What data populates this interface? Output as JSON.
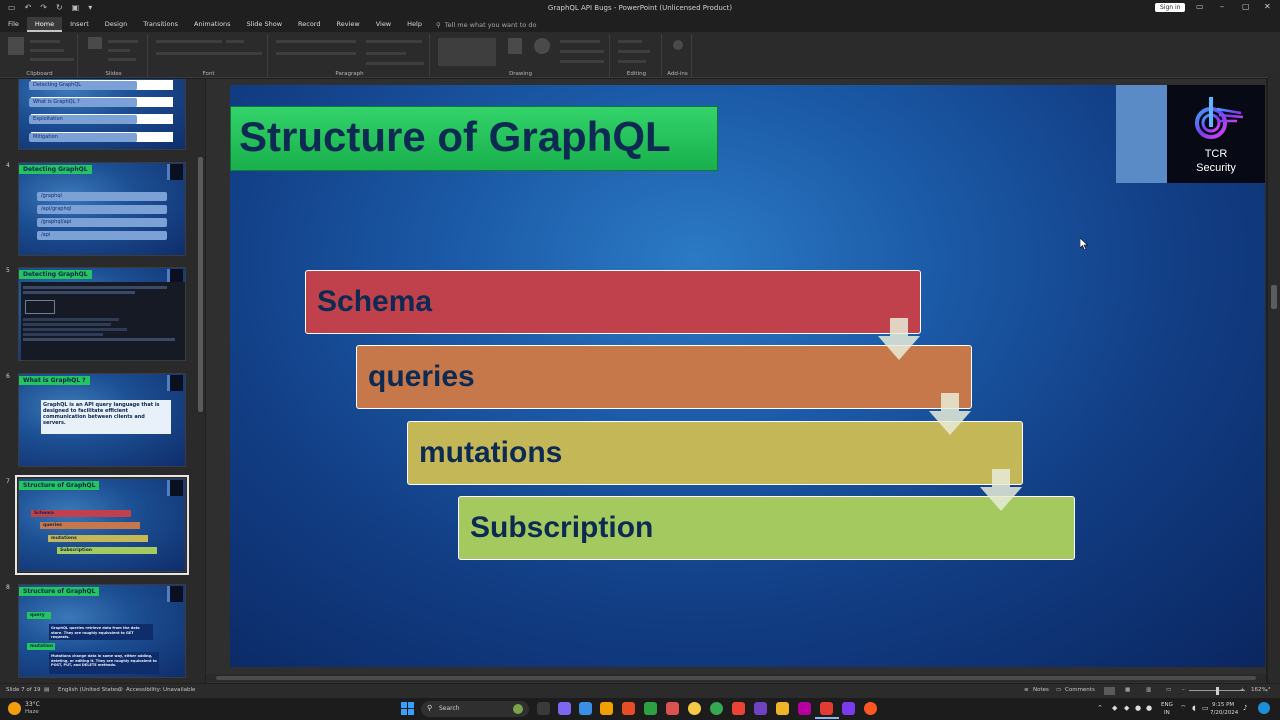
{
  "window": {
    "title": "GraphQL API Bugs  -  PowerPoint (Unlicensed Product)",
    "sign_in": "Sign in"
  },
  "menu": {
    "tabs": [
      "File",
      "Home",
      "Insert",
      "Design",
      "Transitions",
      "Animations",
      "Slide Show",
      "Record",
      "Review",
      "View",
      "Help"
    ],
    "active": "Home",
    "tell_me": "Tell me what you want to do"
  },
  "ribbon": {
    "groups": [
      "Clipboard",
      "Slides",
      "Font",
      "Paragraph",
      "Drawing",
      "Editing",
      "Add-ins"
    ]
  },
  "thumbnails": {
    "s3": {
      "items": [
        "Detecting GraphQL",
        "What is GraphQL ?",
        "Exploitation",
        "Mitigation"
      ]
    },
    "s4": {
      "num": "4",
      "title": "Detecting GraphQL",
      "items": [
        "/graphql",
        "/api/graphql",
        "/graphql/api",
        "/api"
      ]
    },
    "s5": {
      "num": "5",
      "title": "Detecting GraphQL"
    },
    "s6": {
      "num": "6",
      "title": "What is GraphQL ?",
      "text": "GraphQL is an API query language that is designed to facilitate efficient communication between clients and servers."
    },
    "s7": {
      "num": "7",
      "title": "Structure of GraphQL",
      "items": [
        "Schema",
        "queries",
        "mutations",
        "Subscription"
      ]
    },
    "s8": {
      "num": "8",
      "title": "Structure of GraphQL",
      "label1": "query",
      "text1": "GraphQL queries retrieve data from the data store. They are roughly equivalent to GET requests.",
      "label2": "mutation",
      "text2": "Mutations change data in some way, either adding, deleting, or editing it. They are roughly equivalent to POST, PUT, and DELETE methods."
    }
  },
  "slide": {
    "title": "Structure of GraphQL",
    "logo_line1": "TCR",
    "logo_line2": "Security",
    "steps": [
      {
        "label": "Schema",
        "color": "#c0414c"
      },
      {
        "label": "queries",
        "color": "#c7784a"
      },
      {
        "label": "mutations",
        "color": "#c4b758"
      },
      {
        "label": "Subscription",
        "color": "#a3c95f"
      }
    ]
  },
  "status": {
    "slide_info": "Slide 7 of 19",
    "language": "English (United States)",
    "accessibility": "Accessibility: Unavailable",
    "notes": "Notes",
    "comments": "Comments",
    "zoom": "162%"
  },
  "taskbar": {
    "weather_temp": "33°C",
    "weather_desc": "Haze",
    "search": "Search",
    "lang1": "ENG",
    "lang2": "IN",
    "time": "9:15 PM",
    "date": "7/20/2024",
    "colors": [
      "#0078d4",
      "#7b68ee",
      "#3a8ee6",
      "#f0a000",
      "#e44d26",
      "#2ea043",
      "#d9534f",
      "#f7c948",
      "#34a853",
      "#ea4335",
      "#6f42c1",
      "#f0b429",
      "#b4009e",
      "#e03c31",
      "#7c3aed",
      "#ff5722"
    ]
  }
}
